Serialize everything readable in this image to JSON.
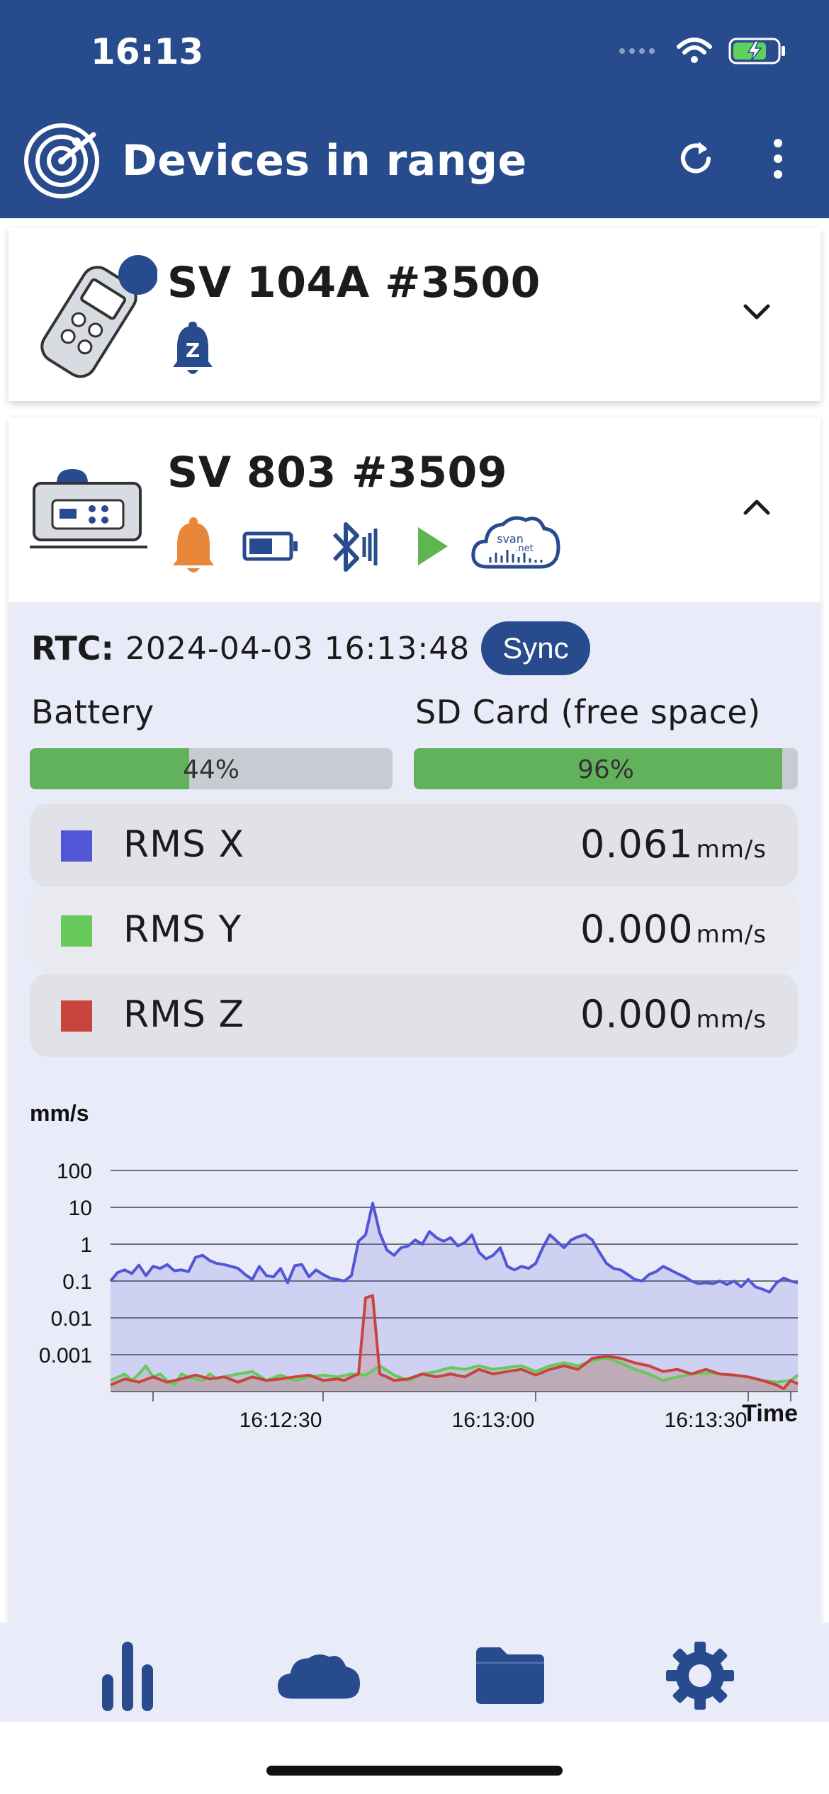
{
  "status_bar": {
    "time": "16:13"
  },
  "app_bar": {
    "title": "Devices in range"
  },
  "devices": [
    {
      "name": "SV 104A #3500"
    },
    {
      "name": "SV 803 #3509"
    }
  ],
  "details": {
    "rtc_label": "RTC:",
    "rtc_value": "2024-04-03 16:13:48",
    "sync_label": "Sync",
    "battery_label": "Battery",
    "battery_text": "44%",
    "battery_value": 0.44,
    "sd_label": "SD Card (free space)",
    "sd_text": "96%",
    "sd_value": 0.96
  },
  "rms": [
    {
      "label": "RMS X",
      "value": "0.061",
      "unit": "mm/s",
      "color": "#5156d6"
    },
    {
      "label": "RMS Y",
      "value": "0.000",
      "unit": "mm/s",
      "color": "#66c95a"
    },
    {
      "label": "RMS Z",
      "value": "0.000",
      "unit": "mm/s",
      "color": "#c8453f"
    }
  ],
  "colors": {
    "brand": "#274b8c",
    "accent_bell": "#e8873a",
    "play": "#5fb550"
  },
  "chart_data": {
    "type": "line",
    "ylabel": "mm/s",
    "xlabel": "Time",
    "y_scale": "log",
    "ylim": [
      0.0001,
      100
    ],
    "y_ticks": [
      {
        "label": "100",
        "value": 100
      },
      {
        "label": "10",
        "value": 10
      },
      {
        "label": "1",
        "value": 1
      },
      {
        "label": "0.1",
        "value": 0.1
      },
      {
        "label": "0.01",
        "value": 0.01
      },
      {
        "label": "0.001",
        "value": 0.001
      }
    ],
    "x_ticks": [
      {
        "label": "16:12:30",
        "t": 30
      },
      {
        "label": "16:13:00",
        "t": 60
      },
      {
        "label": "16:13:30",
        "t": 90
      }
    ],
    "xlim": [
      6,
      103
    ],
    "x_minor_ticks": [
      12,
      36,
      66,
      96,
      102
    ],
    "series": [
      {
        "key": "x",
        "color": "#5156d6",
        "fill": "rgba(81,86,214,0.18)",
        "points": [
          [
            6,
            0.1
          ],
          [
            7,
            0.17
          ],
          [
            8,
            0.2
          ],
          [
            9,
            0.16
          ],
          [
            10,
            0.27
          ],
          [
            11,
            0.14
          ],
          [
            12,
            0.25
          ],
          [
            13,
            0.22
          ],
          [
            14,
            0.28
          ],
          [
            15,
            0.19
          ],
          [
            16,
            0.2
          ],
          [
            17,
            0.18
          ],
          [
            18,
            0.44
          ],
          [
            19,
            0.5
          ],
          [
            20,
            0.36
          ],
          [
            21,
            0.3
          ],
          [
            22,
            0.28
          ],
          [
            23,
            0.25
          ],
          [
            24,
            0.22
          ],
          [
            25,
            0.15
          ],
          [
            26,
            0.11
          ],
          [
            27,
            0.25
          ],
          [
            28,
            0.14
          ],
          [
            29,
            0.13
          ],
          [
            30,
            0.22
          ],
          [
            31,
            0.09
          ],
          [
            32,
            0.26
          ],
          [
            33,
            0.28
          ],
          [
            34,
            0.13
          ],
          [
            35,
            0.2
          ],
          [
            36,
            0.15
          ],
          [
            37,
            0.12
          ],
          [
            38,
            0.11
          ],
          [
            39,
            0.1
          ],
          [
            40,
            0.14
          ],
          [
            41,
            1.2
          ],
          [
            42,
            1.8
          ],
          [
            43,
            13
          ],
          [
            44,
            2.0
          ],
          [
            45,
            0.7
          ],
          [
            46,
            0.5
          ],
          [
            47,
            0.8
          ],
          [
            48,
            0.9
          ],
          [
            49,
            1.3
          ],
          [
            50,
            1.0
          ],
          [
            51,
            2.2
          ],
          [
            52,
            1.5
          ],
          [
            53,
            1.2
          ],
          [
            54,
            1.5
          ],
          [
            55,
            0.9
          ],
          [
            56,
            1.1
          ],
          [
            57,
            1.8
          ],
          [
            58,
            0.6
          ],
          [
            59,
            0.4
          ],
          [
            60,
            0.5
          ],
          [
            61,
            0.8
          ],
          [
            62,
            0.25
          ],
          [
            63,
            0.2
          ],
          [
            64,
            0.25
          ],
          [
            65,
            0.22
          ],
          [
            66,
            0.3
          ],
          [
            67,
            0.8
          ],
          [
            68,
            1.8
          ],
          [
            69,
            1.2
          ],
          [
            70,
            0.8
          ],
          [
            71,
            1.3
          ],
          [
            72,
            1.6
          ],
          [
            73,
            1.8
          ],
          [
            74,
            1.3
          ],
          [
            75,
            0.6
          ],
          [
            76,
            0.3
          ],
          [
            77,
            0.22
          ],
          [
            78,
            0.2
          ],
          [
            79,
            0.15
          ],
          [
            80,
            0.11
          ],
          [
            81,
            0.1
          ],
          [
            82,
            0.15
          ],
          [
            83,
            0.18
          ],
          [
            84,
            0.25
          ],
          [
            85,
            0.2
          ],
          [
            86,
            0.16
          ],
          [
            87,
            0.13
          ],
          [
            88,
            0.1
          ],
          [
            89,
            0.085
          ],
          [
            90,
            0.09
          ],
          [
            91,
            0.085
          ],
          [
            92,
            0.1
          ],
          [
            93,
            0.08
          ],
          [
            94,
            0.1
          ],
          [
            95,
            0.07
          ],
          [
            96,
            0.11
          ],
          [
            97,
            0.07
          ],
          [
            98,
            0.06
          ],
          [
            99,
            0.05
          ],
          [
            100,
            0.09
          ],
          [
            101,
            0.12
          ],
          [
            102,
            0.1
          ],
          [
            103,
            0.09
          ]
        ]
      },
      {
        "key": "y",
        "color": "#66c95a",
        "fill": "rgba(120,150,100,0.20)",
        "points": [
          [
            6,
            0.0002
          ],
          [
            8,
            0.0003
          ],
          [
            9,
            0.0002
          ],
          [
            10,
            0.0003
          ],
          [
            11,
            0.0005
          ],
          [
            12,
            0.00025
          ],
          [
            13,
            0.0003
          ],
          [
            14,
            0.0002
          ],
          [
            15,
            0.00015
          ],
          [
            16,
            0.0003
          ],
          [
            17,
            0.00025
          ],
          [
            18,
            0.00022
          ],
          [
            19,
            0.0002
          ],
          [
            20,
            0.0003
          ],
          [
            21,
            0.00022
          ],
          [
            22,
            0.00025
          ],
          [
            24,
            0.0003
          ],
          [
            26,
            0.00035
          ],
          [
            28,
            0.0002
          ],
          [
            30,
            0.00028
          ],
          [
            32,
            0.0002
          ],
          [
            34,
            0.00025
          ],
          [
            36,
            0.00028
          ],
          [
            38,
            0.00025
          ],
          [
            40,
            0.0003
          ],
          [
            42,
            0.00028
          ],
          [
            44,
            0.0005
          ],
          [
            46,
            0.00028
          ],
          [
            48,
            0.0002
          ],
          [
            50,
            0.0003
          ],
          [
            52,
            0.00035
          ],
          [
            54,
            0.00045
          ],
          [
            56,
            0.0004
          ],
          [
            58,
            0.0005
          ],
          [
            60,
            0.0004
          ],
          [
            62,
            0.00045
          ],
          [
            64,
            0.0005
          ],
          [
            66,
            0.00035
          ],
          [
            68,
            0.0005
          ],
          [
            70,
            0.0006
          ],
          [
            72,
            0.0005
          ],
          [
            74,
            0.0007
          ],
          [
            76,
            0.0008
          ],
          [
            78,
            0.0006
          ],
          [
            80,
            0.0004
          ],
          [
            82,
            0.0003
          ],
          [
            84,
            0.0002
          ],
          [
            86,
            0.00025
          ],
          [
            88,
            0.0003
          ],
          [
            90,
            0.00032
          ],
          [
            92,
            0.0003
          ],
          [
            94,
            0.00028
          ],
          [
            96,
            0.00025
          ],
          [
            98,
            0.0002
          ],
          [
            100,
            0.00018
          ],
          [
            102,
            0.0002
          ],
          [
            103,
            0.00028
          ]
        ]
      },
      {
        "key": "z",
        "color": "#c8453f",
        "fill": "rgba(200,70,70,0.20)",
        "points": [
          [
            6,
            0.00015
          ],
          [
            8,
            0.00022
          ],
          [
            10,
            0.00018
          ],
          [
            12,
            0.00025
          ],
          [
            14,
            0.00018
          ],
          [
            16,
            0.00022
          ],
          [
            18,
            0.00028
          ],
          [
            20,
            0.00022
          ],
          [
            22,
            0.00025
          ],
          [
            24,
            0.00018
          ],
          [
            26,
            0.00025
          ],
          [
            28,
            0.0002
          ],
          [
            30,
            0.00022
          ],
          [
            32,
            0.00025
          ],
          [
            34,
            0.00028
          ],
          [
            36,
            0.0002
          ],
          [
            38,
            0.00022
          ],
          [
            39,
            0.0002
          ],
          [
            40,
            0.00025
          ],
          [
            41,
            0.0003
          ],
          [
            42,
            0.035
          ],
          [
            43,
            0.04
          ],
          [
            44,
            0.0003
          ],
          [
            45,
            0.00025
          ],
          [
            46,
            0.0002
          ],
          [
            48,
            0.00022
          ],
          [
            50,
            0.0003
          ],
          [
            52,
            0.00025
          ],
          [
            54,
            0.0003
          ],
          [
            56,
            0.00025
          ],
          [
            58,
            0.0004
          ],
          [
            60,
            0.0003
          ],
          [
            62,
            0.00035
          ],
          [
            64,
            0.0004
          ],
          [
            66,
            0.00028
          ],
          [
            68,
            0.0004
          ],
          [
            70,
            0.0005
          ],
          [
            72,
            0.0004
          ],
          [
            74,
            0.0008
          ],
          [
            76,
            0.0009
          ],
          [
            78,
            0.0008
          ],
          [
            80,
            0.0006
          ],
          [
            82,
            0.0005
          ],
          [
            84,
            0.00035
          ],
          [
            86,
            0.0004
          ],
          [
            88,
            0.0003
          ],
          [
            90,
            0.0004
          ],
          [
            92,
            0.0003
          ],
          [
            94,
            0.00028
          ],
          [
            96,
            0.00025
          ],
          [
            98,
            0.0002
          ],
          [
            100,
            0.00015
          ],
          [
            101,
            0.00012
          ],
          [
            102,
            0.0002
          ],
          [
            103,
            0.00016
          ]
        ]
      }
    ]
  }
}
